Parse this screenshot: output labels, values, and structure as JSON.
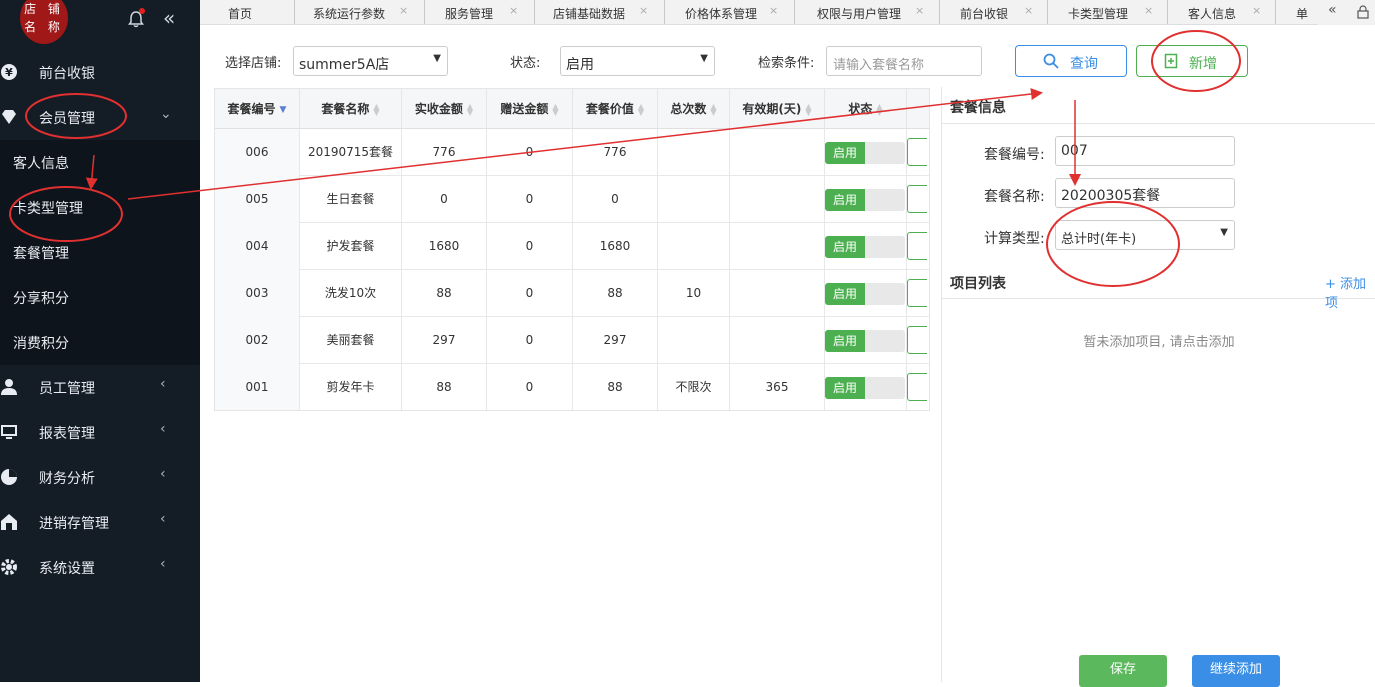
{
  "sidebar": {
    "logo_line1": "店 铺",
    "logo_line2": "名 称",
    "items": [
      {
        "label": "前台收银",
        "icon": "cash-register-icon"
      },
      {
        "label": "会员管理",
        "icon": "diamond-icon"
      },
      {
        "label": "员工管理",
        "icon": "user-icon"
      },
      {
        "label": "报表管理",
        "icon": "monitor-icon"
      },
      {
        "label": "财务分析",
        "icon": "pie-chart-icon"
      },
      {
        "label": "进销存管理",
        "icon": "warehouse-icon"
      },
      {
        "label": "系统设置",
        "icon": "gear-icon"
      }
    ],
    "sub_items": [
      "客人信息",
      "卡类型管理",
      "套餐管理",
      "分享积分",
      "消费积分"
    ]
  },
  "tabs": [
    "首页",
    "系统运行参数",
    "服务管理",
    "店铺基础数据",
    "价格体系管理",
    "权限与用户管理",
    "前台收银",
    "卡类型管理",
    "客人信息",
    "单"
  ],
  "filters": {
    "store_label": "选择店铺:",
    "store_value": "summer5A店",
    "status_label": "状态:",
    "status_value": "启用",
    "search_label": "检索条件:",
    "search_placeholder": "请输入套餐名称",
    "query_button": "查询",
    "add_button": "新增"
  },
  "table": {
    "headers": [
      "套餐编号",
      "套餐名称",
      "实收金额",
      "赠送金额",
      "套餐价值",
      "总次数",
      "有效期(天)",
      "状态"
    ],
    "rows": [
      {
        "id": "006",
        "name": "20190715套餐",
        "paid": "776",
        "gift": "0",
        "value": "776",
        "times": "",
        "validity": "",
        "status": "启用"
      },
      {
        "id": "005",
        "name": "生日套餐",
        "paid": "0",
        "gift": "0",
        "value": "0",
        "times": "",
        "validity": "",
        "status": "启用"
      },
      {
        "id": "004",
        "name": "护发套餐",
        "paid": "1680",
        "gift": "0",
        "value": "1680",
        "times": "",
        "validity": "",
        "status": "启用"
      },
      {
        "id": "003",
        "name": "洗发10次",
        "paid": "88",
        "gift": "0",
        "value": "88",
        "times": "10",
        "validity": "",
        "status": "启用"
      },
      {
        "id": "002",
        "name": "美丽套餐",
        "paid": "297",
        "gift": "0",
        "value": "297",
        "times": "",
        "validity": "",
        "status": "启用"
      },
      {
        "id": "001",
        "name": "剪发年卡",
        "paid": "88",
        "gift": "0",
        "value": "88",
        "times": "不限次",
        "validity": "365",
        "status": "启用"
      }
    ]
  },
  "panel": {
    "title": "套餐信息",
    "code_label": "套餐编号:",
    "code_value": "007",
    "name_label": "套餐名称:",
    "name_value": "20200305套餐",
    "calc_label": "计算类型:",
    "calc_value": "总计时(年卡)",
    "list_title": "项目列表",
    "list_add": "+ 添加项",
    "empty_text": "暂未添加项目, 请点击添加",
    "save_button": "保存",
    "continue_button": "继续添加"
  },
  "colors": {
    "sidebar_bg": "#141c26",
    "primary_blue": "#3a8ee6",
    "success_green": "#4caf50",
    "annotation_red": "#e03030"
  }
}
